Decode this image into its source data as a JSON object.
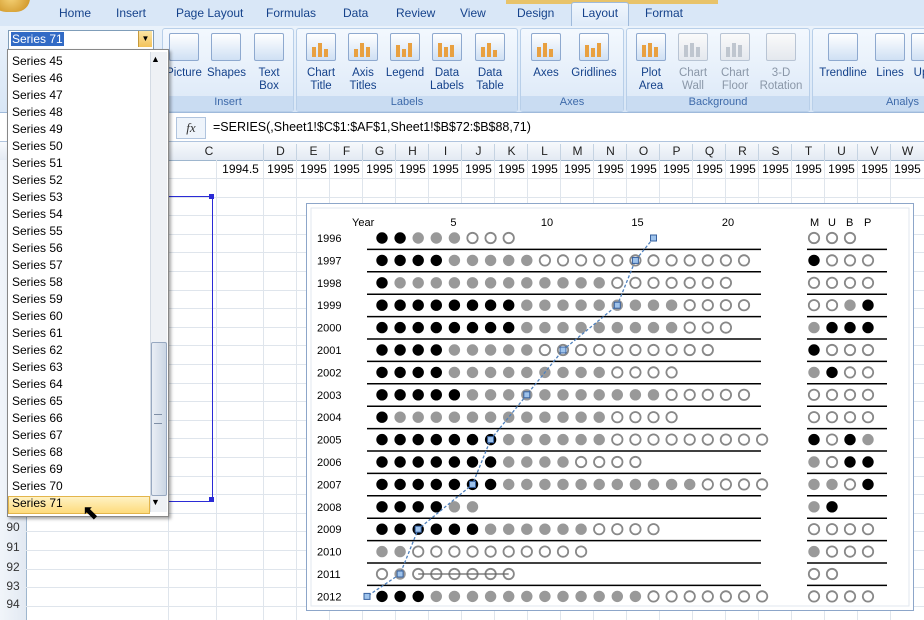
{
  "ribbon_tabs": [
    {
      "label": "Home"
    },
    {
      "label": "Insert"
    },
    {
      "label": "Page Layout"
    },
    {
      "label": "Formulas"
    },
    {
      "label": "Data"
    },
    {
      "label": "Review"
    },
    {
      "label": "View"
    },
    {
      "label": "Design"
    },
    {
      "label": "Layout"
    },
    {
      "label": "Format"
    }
  ],
  "active_tab": "Layout",
  "ribbon": {
    "insert_group": {
      "label": "Insert",
      "buttons": [
        "Picture",
        "Shapes",
        "Text Box"
      ]
    },
    "labels_group": {
      "label": "Labels",
      "buttons": [
        "Chart Title",
        "Axis Titles",
        "Legend",
        "Data Labels",
        "Data Table"
      ]
    },
    "axes_group": {
      "label": "Axes",
      "buttons": [
        "Axes",
        "Gridlines"
      ]
    },
    "background_group": {
      "label": "Background",
      "buttons": [
        "Plot Area",
        "Chart Wall",
        "Chart Floor",
        "3-D Rotation"
      ]
    },
    "analysis_group": {
      "label": "Analys",
      "buttons": [
        "Trendline",
        "Lines",
        "Up"
      ]
    }
  },
  "chart_element_selector": {
    "value": "Series 71"
  },
  "series_list": [
    "Series 45",
    "Series 46",
    "Series 47",
    "Series 48",
    "Series 49",
    "Series 50",
    "Series 51",
    "Series 52",
    "Series 53",
    "Series 54",
    "Series 55",
    "Series 56",
    "Series 57",
    "Series 58",
    "Series 59",
    "Series 60",
    "Series 61",
    "Series 62",
    "Series 63",
    "Series 64",
    "Series 65",
    "Series 66",
    "Series 67",
    "Series 68",
    "Series 69",
    "Series 70",
    "Series 71"
  ],
  "selected_series": "Series 71",
  "formula_bar": {
    "fx": "fx",
    "formula": "=SERIES(,Sheet1!$C$1:$AF$1,Sheet1!$B$72:$B$88,71)"
  },
  "columns": [
    "C",
    "D",
    "E",
    "F",
    "G",
    "H",
    "I",
    "J",
    "K",
    "L",
    "M",
    "N",
    "O",
    "P",
    "Q",
    "R",
    "S",
    "T",
    "U",
    "V",
    "W"
  ],
  "row1_values": [
    "1994.5",
    "1995",
    "1995",
    "1995",
    "1995",
    "1995",
    "1995",
    "1995",
    "1995",
    "1995",
    "1995",
    "1995",
    "1995",
    "1995",
    "1995",
    "1995",
    "1995",
    "1995",
    "1995",
    "1995",
    "1995"
  ],
  "row_numbers": [
    "90",
    "91",
    "92",
    "93",
    "94"
  ],
  "chart_data": {
    "type": "scatter",
    "title": "",
    "x_label": "Year",
    "x_ticks": [
      "5",
      "10",
      "15",
      "20"
    ],
    "right_headers": [
      "M",
      "U",
      "B",
      "P"
    ],
    "years": [
      "1996",
      "1997",
      "1998",
      "1999",
      "2000",
      "2001",
      "2002",
      "2003",
      "2004",
      "2005",
      "2006",
      "2007",
      "2008",
      "2009",
      "2010",
      "2011",
      "2012"
    ],
    "legend_code": "B = black, G = gray, O = open",
    "rows": [
      "BBGGGOOO",
      "BBBBGGGGGOOOOOOOOOOOO",
      "BGGGGGGGGGGGGOOOOOOO",
      "BBBBBBBBGGGGGGGGGOOOO",
      "BBBBBBBBGGGGGGGGGOOO",
      "BBBBGGGGGOOOOOOOOOO",
      "BBBBGGGGGGGGGOOOO",
      "BBBBBGGGGGGGGGGGOOOOO",
      "BGGGGGGGGGGGGOOOO",
      "BBBBBBBGGGGGGOOOOOOOOO",
      "BBBBBBBGGGGOOOO",
      "BBBBBBBGGGGGGGGGGGOOOO",
      "BBBBGG",
      "BBBBBBGGGGGGOOOO",
      "GGOOOOOOOOOO",
      "OGOOOOOO",
      "BBBGGGGGGGGGGGGOOOOOOO"
    ],
    "right_rows": [
      "OOO",
      "BOOO",
      "OOOO",
      "OOGB",
      "GBBB",
      "BOOO",
      "GBOO",
      "OOOO",
      "OOOO",
      "BOBG",
      "GOBB",
      "GGOB",
      "GB",
      "OOOO",
      "GOOO",
      "OO",
      "OOOO"
    ],
    "series71_positions": [
      16,
      15,
      0,
      14,
      0,
      11,
      0,
      9,
      0,
      7,
      0,
      6,
      0,
      3,
      0,
      2,
      1
    ]
  }
}
